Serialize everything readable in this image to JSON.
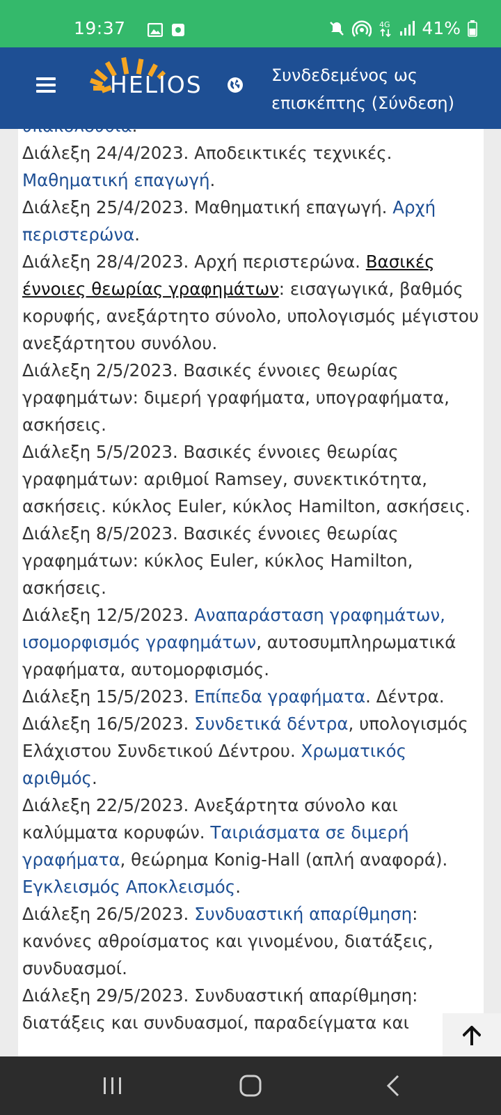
{
  "status_bar": {
    "time": "19:37",
    "battery": "41%",
    "icons": [
      "image-icon",
      "screenshot-icon",
      "mute-icon",
      "hotspot-icon",
      "4g-icon",
      "signal-icon",
      "battery-icon"
    ]
  },
  "header": {
    "logo_text": "HELIOS",
    "login_text": "Συνδεδεμένος ως επισκέπτης (Σύνδεση)",
    "colors": {
      "bar": "#1e4f94",
      "logo_accent": "#f5a623"
    }
  },
  "content": {
    "lines": [
      [
        {
          "t": "υπακολουθία",
          "s": "lk"
        },
        {
          "t": "."
        }
      ],
      [
        {
          "t": "Διάλεξη 24/4/2023. Αποδεικτικές τεχνικές."
        }
      ],
      [
        {
          "t": "Μαθηματική επαγωγή",
          "s": "lk"
        },
        {
          "t": "."
        }
      ],
      [
        {
          "t": "Διάλεξη 25/4/2023. Μαθηματική επαγωγή. "
        },
        {
          "t": "Αρχή",
          "s": "lk"
        }
      ],
      [
        {
          "t": "περιστερώνα",
          "s": "lk"
        },
        {
          "t": "."
        }
      ],
      [
        {
          "t": "Διάλεξη 28/4/2023. Αρχή περιστερώνα. "
        },
        {
          "t": "Βασικές",
          "s": "ul"
        }
      ],
      [
        {
          "t": "έννοιες θεωρίας γραφημάτων",
          "s": "ul"
        },
        {
          "t": ": εισαγωγικά, βαθμός"
        }
      ],
      [
        {
          "t": "κορυφής, ανεξάρτητο σύνολο, υπολογισμός μέγιστου"
        }
      ],
      [
        {
          "t": "ανεξάρτητου συνόλου."
        }
      ],
      [
        {
          "t": "Διάλεξη 2/5/2023. Βασικές έννοιες θεωρίας"
        }
      ],
      [
        {
          "t": "γραφημάτων: διμερή γραφήματα, υπογραφήματα,"
        }
      ],
      [
        {
          "t": "ασκήσεις."
        }
      ],
      [
        {
          "t": "Διάλεξη 5/5/2023. Βασικές έννοιες θεωρίας"
        }
      ],
      [
        {
          "t": "γραφημάτων: αριθμοί Ramsey, συνεκτικότητα,"
        }
      ],
      [
        {
          "t": "ασκήσεις. κύκλος Euler, κύκλος Hamilton, ασκήσεις."
        }
      ],
      [
        {
          "t": "Διάλεξη 8/5/2023. Βασικές έννοιες θεωρίας"
        }
      ],
      [
        {
          "t": "γραφημάτων: κύκλος Euler, κύκλος Hamilton,"
        }
      ],
      [
        {
          "t": "ασκήσεις."
        }
      ],
      [
        {
          "t": "Διάλεξη 12/5/2023. "
        },
        {
          "t": "Αναπαράσταση γραφημάτων,",
          "s": "lk"
        }
      ],
      [
        {
          "t": "ισομορφισμός γραφημάτων",
          "s": "lk"
        },
        {
          "t": ", αυτοσυμπληρωματικά"
        }
      ],
      [
        {
          "t": "γραφήματα, αυτομορφισμός."
        }
      ],
      [
        {
          "t": "Διάλεξη 15/5/2023. "
        },
        {
          "t": "Επίπεδα γραφήματα",
          "s": "lk"
        },
        {
          "t": ". Δέντρα."
        }
      ],
      [
        {
          "t": "Διάλεξη 16/5/2023. "
        },
        {
          "t": "Συνδετικά δέντρα",
          "s": "lk"
        },
        {
          "t": ", υπολογισμός"
        }
      ],
      [
        {
          "t": "Ελάχιστου Συνδετικού Δέντρου. "
        },
        {
          "t": "Χρωματικός",
          "s": "lk"
        }
      ],
      [
        {
          "t": "αριθμός",
          "s": "lk"
        },
        {
          "t": "."
        }
      ],
      [
        {
          "t": "Διάλεξη 22/5/2023. Ανεξάρτητα σύνολο και"
        }
      ],
      [
        {
          "t": "καλύμματα κορυφών. "
        },
        {
          "t": "Ταιριάσματα σε διμερή",
          "s": "lk"
        }
      ],
      [
        {
          "t": "γραφήματα",
          "s": "lk"
        },
        {
          "t": ", θεώρημα Konig-Hall (απλή αναφορά)."
        }
      ],
      [
        {
          "t": "Εγκλεισμός Αποκλεισμός",
          "s": "lk"
        },
        {
          "t": "."
        }
      ],
      [
        {
          "t": "Διάλεξη 26/5/2023. "
        },
        {
          "t": "Συνδυαστική απαρίθμηση",
          "s": "lk"
        },
        {
          "t": ":"
        }
      ],
      [
        {
          "t": "κανόνες αθροίσματος και γινομένου, διατάξεις,"
        }
      ],
      [
        {
          "t": "συνδυασμοί."
        }
      ],
      [
        {
          "t": "Διάλεξη 29/5/2023. Συνδυαστική απαρίθμηση:"
        }
      ],
      [
        {
          "t": "διατάξεις και συνδυασμοί, παραδείγματα και"
        }
      ]
    ]
  },
  "scroll_top": {
    "icon": "arrow-up-icon"
  },
  "nav_bar": {
    "icons": [
      "recents-icon",
      "home-icon",
      "back-icon"
    ]
  }
}
